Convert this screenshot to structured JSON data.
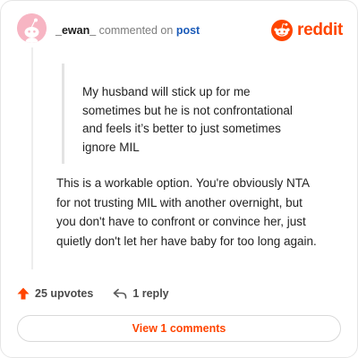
{
  "header": {
    "username": "_ewan_",
    "action_text": "commented on",
    "post_link": "post",
    "brand": "reddit"
  },
  "comment": {
    "quote": "My husband will stick up for me\nsometimes but he is not confrontational\nand feels it’s better to just sometimes\nignore MIL",
    "body": "This is a workable option. You're obviously NTA\nfor not trusting MIL with another overnight, but\nyou don't have to confront or convince her, just\nquietly don't let her have baby for too long again."
  },
  "actions": {
    "upvotes": "25 upvotes",
    "replies": "1 reply",
    "upvote_icon": "upvote-arrow-icon",
    "reply_icon": "reply-arrow-icon"
  },
  "footer": {
    "view_comments": "View 1 comments"
  },
  "colors": {
    "brand": "#ff4500",
    "link": "#1a5ab8",
    "avatar_bg": "#f7b5c3"
  }
}
